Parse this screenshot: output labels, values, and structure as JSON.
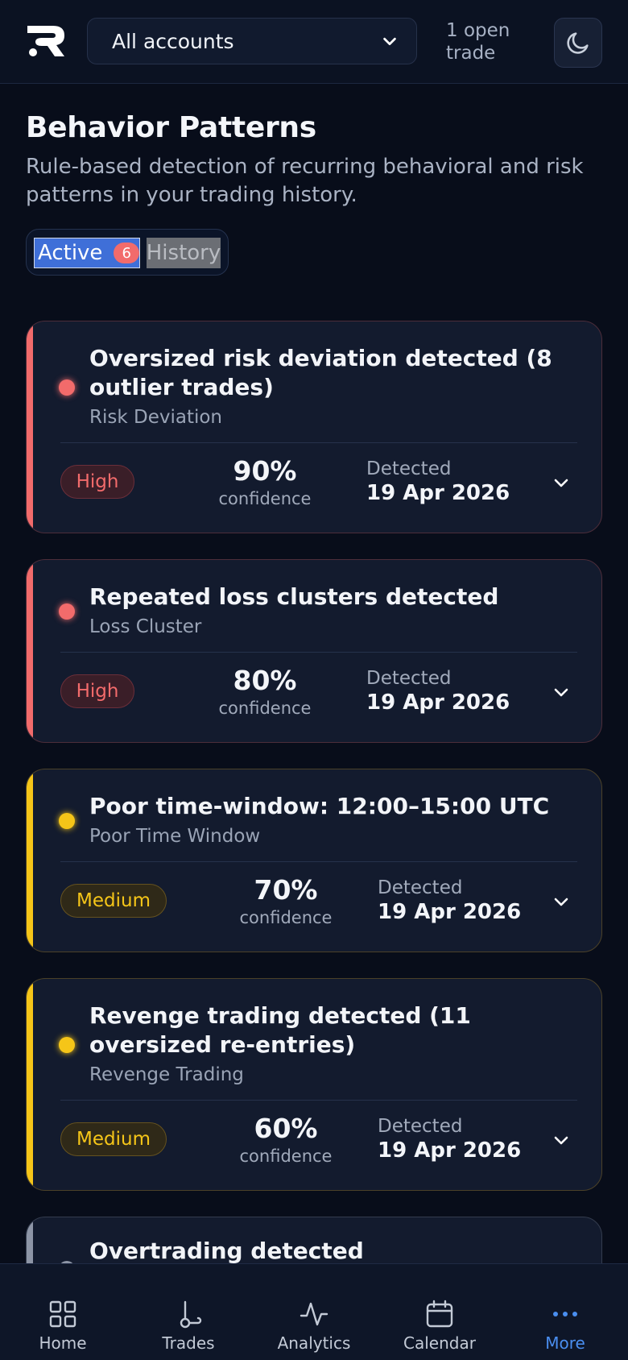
{
  "header": {
    "account_select": "All accounts",
    "open_trades": "1 open trade"
  },
  "page": {
    "title": "Behavior Patterns",
    "subtitle": "Rule-based detection of recurring behavioral and risk patterns in your trading history."
  },
  "tabs": {
    "active_label": "Active",
    "active_count": "6",
    "history_label": "History"
  },
  "colors": {
    "high": "#f26b6b",
    "medium": "#f5c518",
    "low": "#8d95a6",
    "accent": "#4a8ef0"
  },
  "patterns": [
    {
      "title": "Oversized risk deviation detected (8 outlier trades)",
      "category": "Risk Deviation",
      "severity": "High",
      "confidence": "90%",
      "confidence_label": "confidence",
      "detected_label": "Detected",
      "detected_date": "19 Apr 2026"
    },
    {
      "title": "Repeated loss clusters detected",
      "category": "Loss Cluster",
      "severity": "High",
      "confidence": "80%",
      "confidence_label": "confidence",
      "detected_label": "Detected",
      "detected_date": "19 Apr 2026"
    },
    {
      "title": "Poor time-window: 12:00–15:00 UTC",
      "category": "Poor Time Window",
      "severity": "Medium",
      "confidence": "70%",
      "confidence_label": "confidence",
      "detected_label": "Detected",
      "detected_date": "19 Apr 2026"
    },
    {
      "title": "Revenge trading detected (11 oversized re-entries)",
      "category": "Revenge Trading",
      "severity": "Medium",
      "confidence": "60%",
      "confidence_label": "confidence",
      "detected_label": "Detected",
      "detected_date": "19 Apr 2026"
    },
    {
      "title": "Overtrading detected"
    }
  ],
  "bottom_nav": [
    {
      "label": "Home",
      "icon": "grid-icon"
    },
    {
      "label": "Trades",
      "icon": "trades-icon"
    },
    {
      "label": "Analytics",
      "icon": "pulse-icon"
    },
    {
      "label": "Calendar",
      "icon": "calendar-icon"
    },
    {
      "label": "More",
      "icon": "more-dots-icon",
      "active": true
    }
  ]
}
